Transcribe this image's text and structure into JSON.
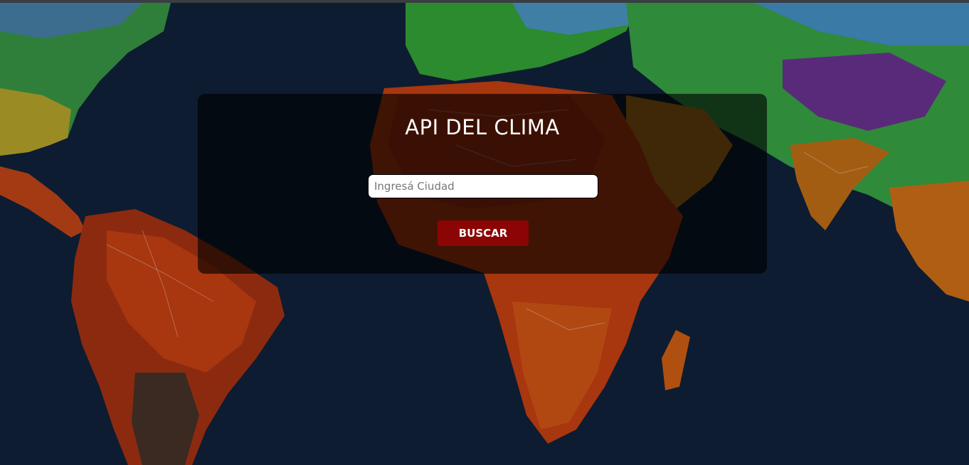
{
  "page": {
    "title": "API DEL CLIMA"
  },
  "search": {
    "placeholder": "Ingresá Ciudad",
    "value": "",
    "button_label": "BUSCAR"
  },
  "colors": {
    "button_bg": "#8b0504",
    "card_bg": "rgba(0,0,0,0.62)",
    "ocean": "#0b1a2e"
  }
}
